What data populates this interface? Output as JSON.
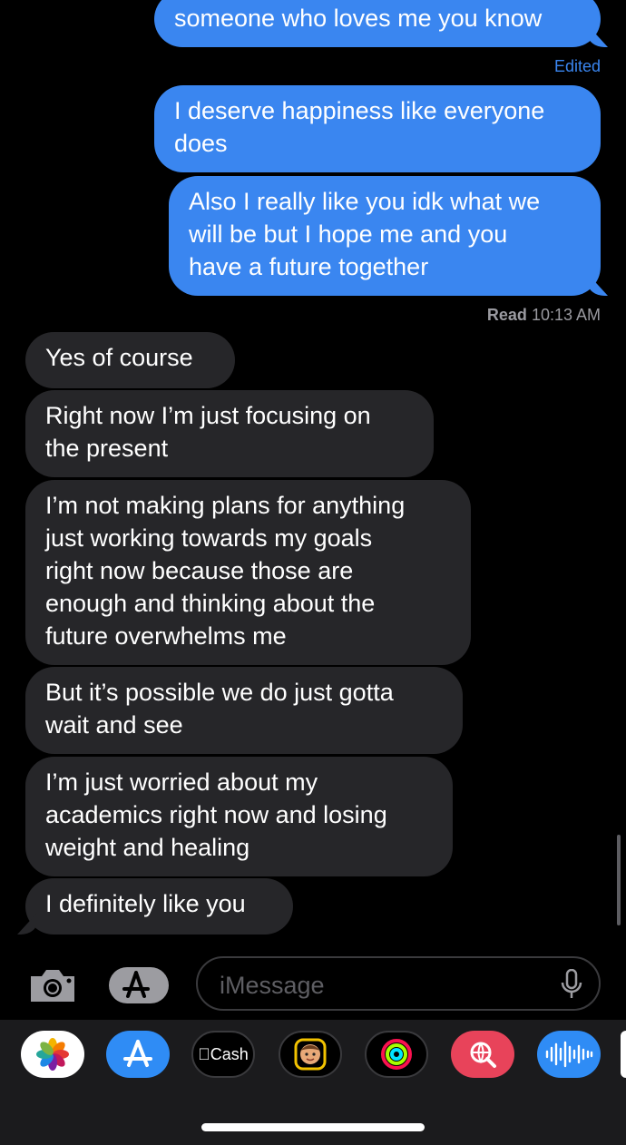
{
  "thread": {
    "messages": [
      {
        "id": "m0",
        "direction": "sent",
        "text": "someone who loves me you know"
      },
      {
        "id": "m1",
        "direction": "sent",
        "text": "I deserve happiness like everyone\ndoes"
      },
      {
        "id": "m2",
        "direction": "sent",
        "text": "Also I really like you idk what we\nwill be but I hope me and you\nhave a future together"
      },
      {
        "id": "m3",
        "direction": "received",
        "text": "Yes of course"
      },
      {
        "id": "m4",
        "direction": "received",
        "text": "Right now I’m just focusing on\nthe present"
      },
      {
        "id": "m5",
        "direction": "received",
        "text": "I’m not making plans for anything\njust working towards my goals\nright now because those are\nenough and thinking about the\nfuture overwhelms me"
      },
      {
        "id": "m6",
        "direction": "received",
        "text": "But it’s possible we do just gotta\nwait and see"
      },
      {
        "id": "m7",
        "direction": "received",
        "text": "I’m just worried about my\nacademics right now and losing\nweight and healing"
      },
      {
        "id": "m8",
        "direction": "received",
        "text": "I definitely like you"
      }
    ],
    "edited_label": "Edited",
    "read_receipt": {
      "label": "Read",
      "time": "10:13 AM"
    }
  },
  "compose": {
    "placeholder": "iMessage",
    "value": "",
    "camera_icon": "camera-icon",
    "apps_icon": "app-store-icon",
    "mic_icon": "microphone-icon"
  },
  "app_drawer": {
    "apps": [
      {
        "name": "photos",
        "icon": "photos-icon"
      },
      {
        "name": "app-store",
        "icon": "app-store-icon"
      },
      {
        "name": "apple-cash",
        "icon": "apple-cash-icon",
        "label": "Cash"
      },
      {
        "name": "memoji",
        "icon": "memoji-icon"
      },
      {
        "name": "activity",
        "icon": "activity-rings-icon"
      },
      {
        "name": "images-search",
        "icon": "globe-search-icon"
      },
      {
        "name": "audio",
        "icon": "audio-waveform-icon"
      }
    ]
  },
  "colors": {
    "sent_bubble": "#3a86f0",
    "received_bubble": "#262629",
    "background": "#000000",
    "edited_text": "#3a86f0"
  }
}
